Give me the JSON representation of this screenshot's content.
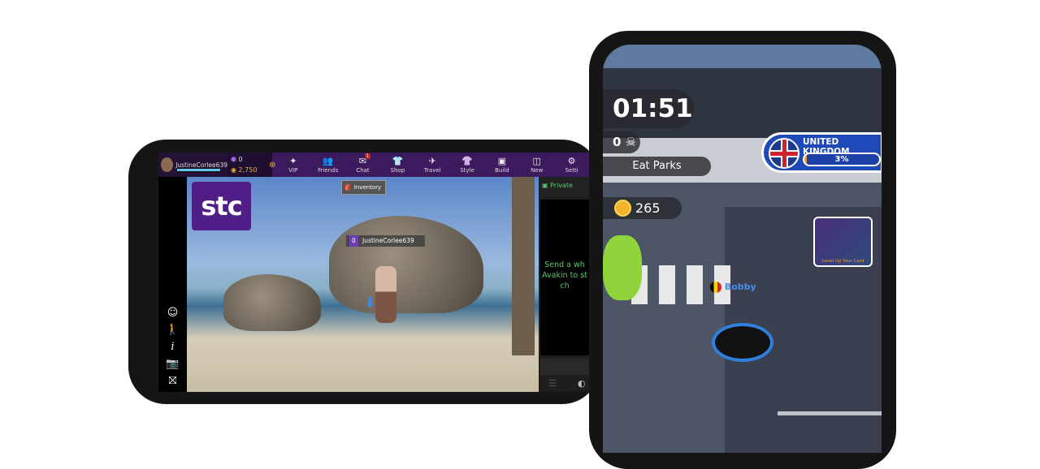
{
  "landscape_game": {
    "username": "JustineCorlee639",
    "level": "0",
    "gems": "0",
    "coins": "2,750",
    "nav": [
      {
        "label": "VIP",
        "icon": "vip-star-icon"
      },
      {
        "label": "Friends",
        "icon": "friends-icon"
      },
      {
        "label": "Chat",
        "icon": "chat-envelope-icon",
        "badge": "1"
      },
      {
        "label": "Shop",
        "icon": "shirt-icon"
      },
      {
        "label": "Travel",
        "icon": "plane-icon"
      },
      {
        "label": "Style",
        "icon": "hanger-icon"
      },
      {
        "label": "Build",
        "icon": "box-icon"
      },
      {
        "label": "New",
        "icon": "new-icon"
      },
      {
        "label": "Setti",
        "icon": "gear-icon"
      }
    ],
    "ad_logo": "stc",
    "inventory_label": "Inventory",
    "player_tag": "JustineCorlee639",
    "player_level": "0",
    "chat": {
      "tab": "Private",
      "message": [
        "Send a wh",
        "Avakin to st",
        "ch"
      ]
    },
    "colors": {
      "bar": "#3c1a5e",
      "chat_text": "#58c86e",
      "stc": "#4f1f87"
    }
  },
  "portrait_game": {
    "timer": "01:51",
    "kills": "0",
    "location": "Eat Parks",
    "coins": "265",
    "country": "UNITED KINGDOM",
    "progress_percent": 3,
    "progress_label": "3%",
    "ad_text": "Level Up Your Card",
    "player_name": "Bobby",
    "colors": {
      "country_panel": "#1f49b8",
      "hole_ring": "#2f7fe0"
    }
  }
}
